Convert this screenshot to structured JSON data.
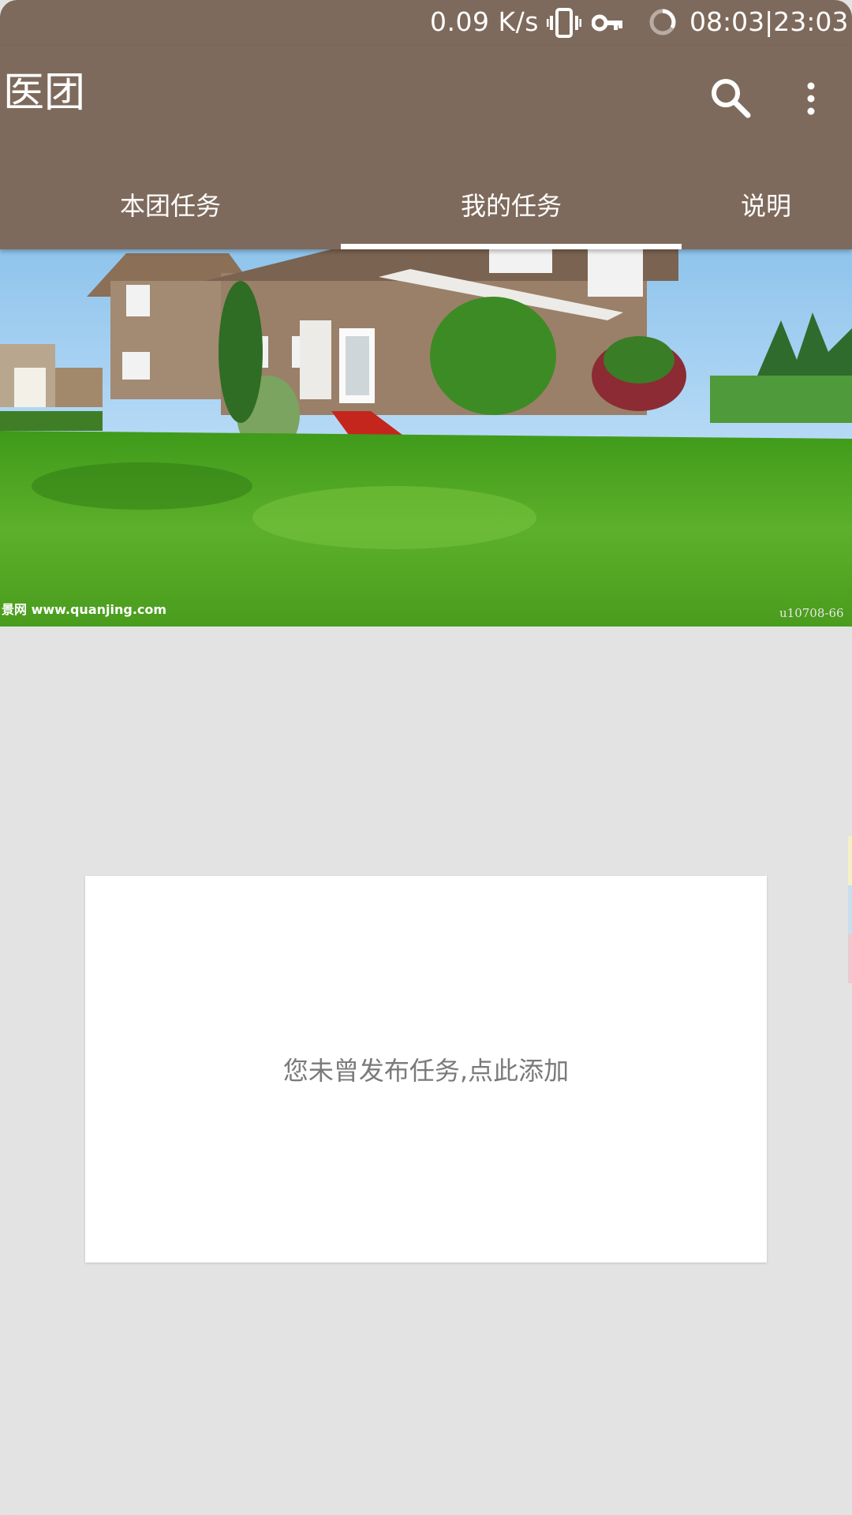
{
  "status_bar": {
    "network_speed": "0.09 K/s",
    "time": "08:03|23:03",
    "icons": [
      "vibrate-icon",
      "vpn-key-icon",
      "loading-icon"
    ]
  },
  "app_bar": {
    "title": "医团",
    "actions": [
      "search-icon",
      "more-vert-icon"
    ]
  },
  "tabs": [
    {
      "label": "本团任务",
      "selected": false
    },
    {
      "label": "我的任务",
      "selected": true
    },
    {
      "label": "说明",
      "selected": false
    }
  ],
  "banner": {
    "watermark_left": "景网 www.quanjing.com",
    "watermark_right": "u10708-66"
  },
  "empty_state": {
    "message": "您未曾发布任务,点此添加"
  },
  "colors": {
    "primary": "#7e6a5c",
    "background": "#e3e3e3",
    "card": "#ffffff",
    "hint_text": "#7a7a7a",
    "tab_indicator": "#ffffff"
  }
}
